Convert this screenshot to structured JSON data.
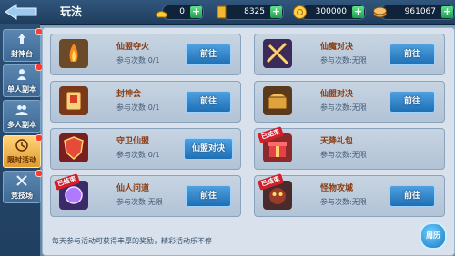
{
  "header": {
    "title": "玩法",
    "currencies": [
      {
        "name": "gold-ingot",
        "value": "0"
      },
      {
        "name": "gold-bar",
        "value": "8325"
      },
      {
        "name": "coin",
        "value": "300000"
      },
      {
        "name": "copper",
        "value": "961067"
      }
    ]
  },
  "sidebar": {
    "items": [
      {
        "label": "封神台",
        "active": false,
        "badge": true
      },
      {
        "label": "单人副本",
        "active": false,
        "badge": true
      },
      {
        "label": "多人副本",
        "active": false,
        "badge": false
      },
      {
        "label": "限时活动",
        "active": true,
        "badge": true
      },
      {
        "label": "竞技场",
        "active": false,
        "badge": true
      }
    ]
  },
  "activities": [
    {
      "name": "仙盟夺火",
      "count": "参与次数:0/1",
      "button": "前往",
      "ended": false
    },
    {
      "name": "仙魔对决",
      "count": "参与次数:无限",
      "button": "前往",
      "ended": false
    },
    {
      "name": "封神会",
      "count": "参与次数:0/1",
      "button": "前往",
      "ended": false
    },
    {
      "name": "仙盟对决",
      "count": "参与次数:无限",
      "button": "前往",
      "ended": false
    },
    {
      "name": "守卫仙盟",
      "count": "参与次数:0/1",
      "button": "仙盟对决",
      "ended": false
    },
    {
      "name": "天降礼包",
      "count": "参与次数:无限",
      "button": "",
      "ended": true
    },
    {
      "name": "仙人问道",
      "count": "参与次数:无限",
      "button": "前往",
      "ended": true
    },
    {
      "name": "怪物攻城",
      "count": "参与次数:无限",
      "button": "前往",
      "ended": true
    }
  ],
  "ended_label": "已结束",
  "footer": {
    "tip": "每天参与活动可获得丰厚的奖励，精彩活动乐不停",
    "weekly_button": "周历"
  },
  "colors": {
    "accent": "#1f6fb4",
    "active_tab": "#e19a2e",
    "badge": "#ff3b2f"
  }
}
